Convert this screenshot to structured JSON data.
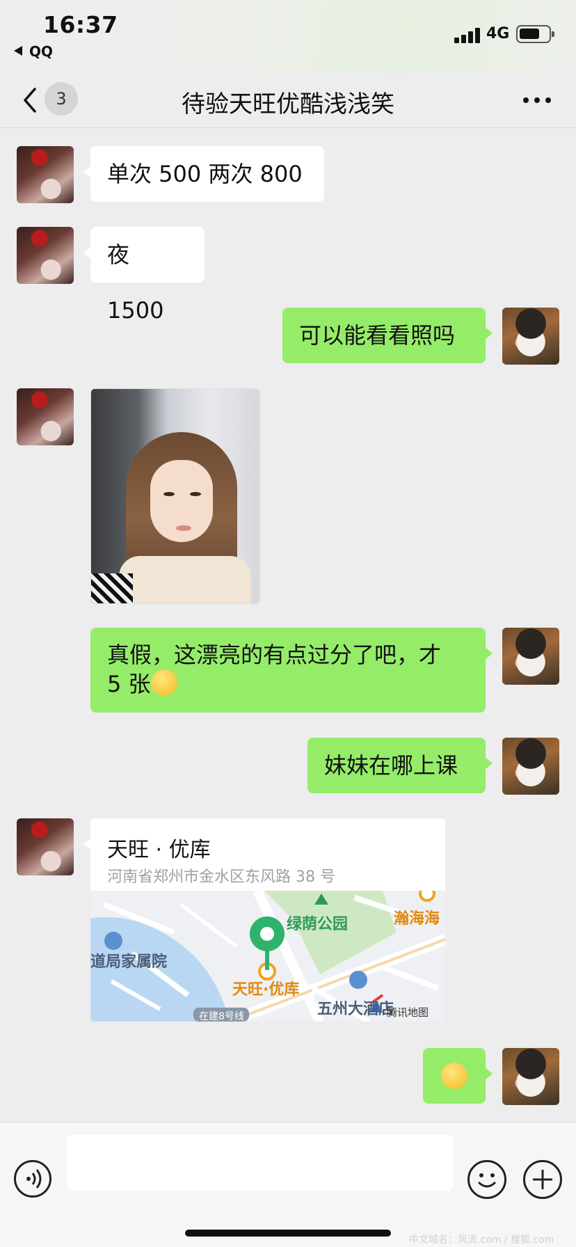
{
  "status_bar": {
    "time": "16:37",
    "back_app": "QQ",
    "network": "4G"
  },
  "nav": {
    "unread_count": "3",
    "title": "待验天旺优酷浅浅笑"
  },
  "messages": [
    {
      "side": "left",
      "type": "text",
      "text": "单次 500  两次 800"
    },
    {
      "side": "left",
      "type": "text",
      "text": "夜 1500"
    },
    {
      "side": "right",
      "type": "text",
      "text": "可以能看看照吗"
    },
    {
      "side": "left",
      "type": "image"
    },
    {
      "side": "right",
      "type": "text",
      "line1": "真假，这漂亮的有点过分了吧，才",
      "line2": "5 张",
      "emoji": "crying-face-emoji"
    },
    {
      "side": "right",
      "type": "text",
      "text": "妹妹在哪上课"
    },
    {
      "side": "left",
      "type": "location",
      "name": "天旺 · 优库",
      "address": "河南省郑州市金水区东风路 38 号"
    },
    {
      "side": "right",
      "type": "emoji",
      "emoji": "sweat-face-emoji"
    }
  ],
  "map": {
    "labels": {
      "park": "绿荫公园",
      "place_right": "瀚海海",
      "family_court": "道局家属院",
      "target": "天旺·优库",
      "hotel": "五州大酒店",
      "metro": "在建8号线",
      "provider": "腾讯地图"
    }
  },
  "watermark": "中文域名：风流.com / 搜狐.com",
  "colors": {
    "background": "#ededed",
    "my_bubble": "#95ec69",
    "their_bubble": "#ffffff",
    "map_pin": "#2fb36c"
  }
}
